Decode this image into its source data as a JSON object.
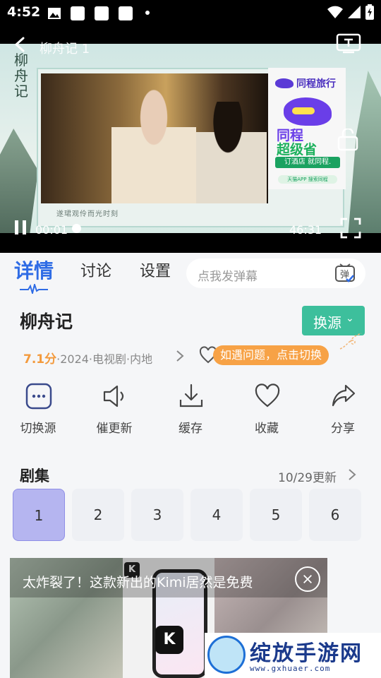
{
  "status_bar": {
    "time": "4:52"
  },
  "player": {
    "title": "柳舟记 1",
    "current_time": "00:01",
    "duration": "46:31",
    "brand_text": "柳舟记",
    "caption": "遂珺观伶而光时刻",
    "ad": {
      "logo": "同程旅行",
      "slogan_1": "同程",
      "slogan_2": "超级省",
      "tag": "订酒店 就同程.",
      "small": "天猫APP 搜索同程"
    }
  },
  "tabs": [
    {
      "label": "详情",
      "active": true
    },
    {
      "label": "讨论",
      "active": false
    },
    {
      "label": "设置",
      "active": false
    }
  ],
  "danmu": {
    "placeholder": "点我发弹幕",
    "icon_text": "弹"
  },
  "show": {
    "title": "柳舟记",
    "score": "7.1分",
    "meta": "·2024·电视剧·内地"
  },
  "source_button": {
    "label": "换源"
  },
  "tip": "如遇问题，点击切换",
  "actions": [
    {
      "label": "切换源",
      "icon": "more-icon"
    },
    {
      "label": "催更新",
      "icon": "speaker-icon"
    },
    {
      "label": "缓存",
      "icon": "download-icon"
    },
    {
      "label": "收藏",
      "icon": "heart-icon"
    },
    {
      "label": "分享",
      "icon": "share-icon"
    }
  ],
  "episodes": {
    "header": "剧集",
    "update": "10/29更新",
    "items": [
      "1",
      "2",
      "3",
      "4",
      "5",
      "6"
    ],
    "selected": "1"
  },
  "bottom_ad": {
    "text": "太炸裂了！这款新出的Kimi居然是免费",
    "logo": "K"
  },
  "watermark": {
    "name": "绽放手游网",
    "url": "www.gxhuaer.com"
  }
}
